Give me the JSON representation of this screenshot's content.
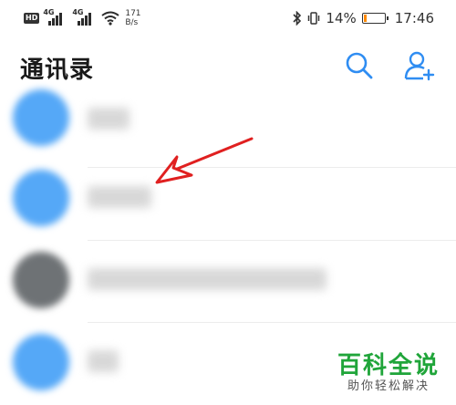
{
  "status_bar": {
    "hd_label": "HD",
    "network1": "4G",
    "network2": "4G",
    "speed_value": "171",
    "speed_unit": "B/s",
    "battery_percent": "14%",
    "battery_level": 0.14,
    "battery_color": "#ff8a00",
    "time": "17:46",
    "icons": [
      "hd-icon",
      "signal-icon",
      "signal-icon",
      "wifi-icon",
      "bluetooth-icon",
      "vibrate-icon",
      "battery-icon"
    ]
  },
  "header": {
    "title": "通讯录",
    "accent_color": "#2f8df2",
    "icons": [
      "search-icon",
      "add-contact-icon"
    ]
  },
  "contacts": [
    {
      "avatar_color": "#55a8f7"
    },
    {
      "avatar_color": "#55a8f7"
    },
    {
      "avatar_color": "#6e7275"
    },
    {
      "avatar_color": "#55a8f7"
    }
  ],
  "annotation": {
    "arrow_color": "#e02020"
  },
  "watermark": {
    "title": "百科全说",
    "subtitle": "助你轻松解决",
    "color": "#20a53a"
  }
}
